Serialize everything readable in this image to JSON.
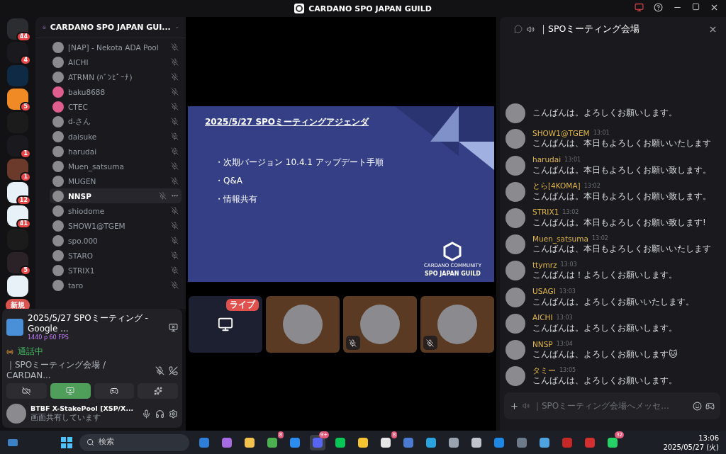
{
  "window": {
    "title": "CARDANO SPO JAPAN GUILD"
  },
  "servers": [
    {
      "badge": "44",
      "kind": "discord"
    },
    {
      "badge": "4",
      "kind": "dots"
    },
    {
      "kind": "square"
    },
    {
      "badge": "5",
      "kind": "orange"
    },
    {
      "kind": "ring"
    },
    {
      "badge": "1",
      "kind": "dots"
    },
    {
      "badge": "1",
      "kind": "brown"
    },
    {
      "badge": "12",
      "kind": "app"
    },
    {
      "badge": "41",
      "kind": "app"
    },
    {
      "kind": "ring"
    },
    {
      "badge": "5",
      "kind": "red"
    },
    {
      "kind": "app"
    }
  ],
  "new_pill": "新規",
  "guild": {
    "name": "CARDANO SPO JAPAN GUI..."
  },
  "members": [
    {
      "name": "[NAP] - Nekota ADA Pool",
      "default_avatar": false,
      "highlighted": false
    },
    {
      "name": "AICHI",
      "default_avatar": false,
      "highlighted": false
    },
    {
      "name": "ATRMN (ﾊﾞﾝﾋﾟｰﾅ)",
      "default_avatar": false,
      "highlighted": false
    },
    {
      "name": "baku8688",
      "default_avatar": true,
      "highlighted": false
    },
    {
      "name": "CTEC",
      "default_avatar": true,
      "highlighted": false
    },
    {
      "name": "d-さん",
      "default_avatar": false,
      "highlighted": false
    },
    {
      "name": "daisuke",
      "default_avatar": false,
      "highlighted": false
    },
    {
      "name": "harudai",
      "default_avatar": false,
      "highlighted": false
    },
    {
      "name": "Muen_satsuma",
      "default_avatar": false,
      "highlighted": false
    },
    {
      "name": "MUGEN",
      "default_avatar": false,
      "highlighted": false
    },
    {
      "name": "NNSP",
      "default_avatar": false,
      "highlighted": true
    },
    {
      "name": "shiodome",
      "default_avatar": false,
      "highlighted": false
    },
    {
      "name": "SHOW1@TGEM",
      "default_avatar": false,
      "highlighted": false
    },
    {
      "name": "spo.000",
      "default_avatar": false,
      "highlighted": false
    },
    {
      "name": "STARO",
      "default_avatar": false,
      "highlighted": false
    },
    {
      "name": "STRIX1",
      "default_avatar": false,
      "highlighted": false
    },
    {
      "name": "taro",
      "default_avatar": false,
      "highlighted": false
    }
  ],
  "voice_panel": {
    "stream_title": "2025/5/27 SPOミーティング - Google ...",
    "stream_quality": "1440 p 60 FPS",
    "status": "通話中",
    "channel": "｜SPOミーティング会場 / CARDAN...",
    "controls": [
      {
        "kind": "camera",
        "selected": false
      },
      {
        "kind": "screen",
        "selected": true
      },
      {
        "kind": "activity",
        "selected": false
      },
      {
        "kind": "soundboard",
        "selected": false
      }
    ],
    "user": {
      "name": "BTBF X-StakePool [XSP/X...",
      "status": "画面共有しています"
    }
  },
  "slide": {
    "title": "2025/5/27 SPOミーティングアジェンダ",
    "bullets": [
      "・次期バージョン 10.4.1 アップデート手順",
      "・Q&A",
      "・情報共有"
    ],
    "logo_caption": "CARDANO COMMUNITY",
    "logo_name": "SPO JAPAN GUILD"
  },
  "tiles": [
    {
      "kind": "stream",
      "badge": "ライブ",
      "muted": false
    },
    {
      "kind": "avatar",
      "muted": false
    },
    {
      "kind": "avatar",
      "muted": true
    },
    {
      "kind": "avatar",
      "muted": true
    }
  ],
  "chat": {
    "channel": "｜SPOミーティング会場",
    "placeholder": "｜SPOミーティング会場へメッセ...",
    "messages": [
      {
        "text": "こんばんは。よろしくお願いします。"
      },
      {
        "name": "SHOW1@TGEM",
        "time": "13:01",
        "text": "こんばんは、本日もよろしくお願いいたします"
      },
      {
        "name": "harudai",
        "time": "13:01",
        "text": "こんばんは。本日もよろしくお願い致します。"
      },
      {
        "name": "とら[4KOMA]",
        "time": "13:02",
        "text": "こんばんは。本日もよろしくお願い致します。"
      },
      {
        "name": "STRIX1",
        "time": "13:02",
        "text": "こんばんは。本日もよろしくお願い致します!"
      },
      {
        "name": "Muen_satsuma",
        "time": "13:02",
        "text": "こんばんは、本日もよろしくお願いいたします"
      },
      {
        "name": "ttymrz",
        "time": "13:03",
        "text": "こんばんは！よろしくお願いします。"
      },
      {
        "name": "USAGI",
        "time": "13:03",
        "text": "こんばんは。よろしくお願いいたします。"
      },
      {
        "name": "AICHI",
        "time": "13:03",
        "text": "こんばんは。よろしくお願いします。"
      },
      {
        "name": "NNSP",
        "time": "13:04",
        "text": "こんばんは、よろしくお願いします🐱"
      },
      {
        "name": "タミー",
        "time": "13:05",
        "text": "こんばんは、よろしくお願いします。"
      }
    ]
  },
  "taskbar": {
    "search": "検索",
    "apps": [
      {
        "kind": "files"
      },
      {
        "kind": "copilot"
      },
      {
        "kind": "folder"
      },
      {
        "kind": "chrome",
        "badge": "8"
      },
      {
        "kind": "code"
      },
      {
        "kind": "discord",
        "badge": "9+",
        "selected": true
      },
      {
        "kind": "line"
      },
      {
        "kind": "note"
      },
      {
        "kind": "chat",
        "badge": "8"
      },
      {
        "kind": "network"
      },
      {
        "kind": "telegram"
      },
      {
        "kind": "calculator"
      },
      {
        "kind": "snip"
      },
      {
        "kind": "u"
      },
      {
        "kind": "remote"
      },
      {
        "kind": "notepad"
      },
      {
        "kind": "record"
      },
      {
        "kind": "ftp"
      },
      {
        "kind": "whatsapp",
        "badge": "32"
      }
    ],
    "time": "13:06",
    "date": "2025/05/27 (火)"
  }
}
